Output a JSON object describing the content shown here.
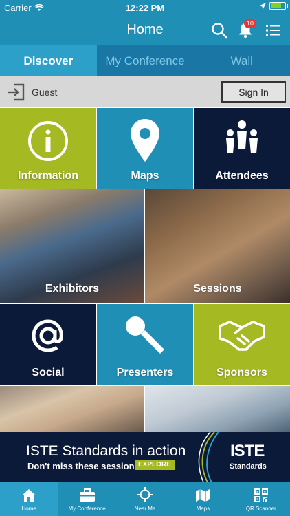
{
  "status": {
    "carrier": "Carrier",
    "time": "12:22 PM"
  },
  "nav": {
    "title": "Home",
    "badge": "10"
  },
  "tabs": [
    {
      "label": "Discover",
      "active": true
    },
    {
      "label": "My Conference",
      "active": false
    },
    {
      "label": "Wall",
      "active": false
    }
  ],
  "guest": {
    "label": "Guest",
    "signin": "Sign In"
  },
  "tiles": {
    "information": "Information",
    "maps": "Maps",
    "attendees": "Attendees",
    "exhibitors": "Exhibitors",
    "sessions": "Sessions",
    "social": "Social",
    "presenters": "Presenters",
    "sponsors": "Sponsors"
  },
  "banner": {
    "title": "ISTE Standards in action",
    "subtitle": "Don't miss these sessions!",
    "explore": "EXPLORE",
    "logo_top": "ISTE",
    "logo_bottom": "Standards"
  },
  "tabbar": [
    {
      "label": "Home",
      "icon": "home-icon",
      "active": true
    },
    {
      "label": "My Conference",
      "icon": "briefcase-icon",
      "active": false
    },
    {
      "label": "Near Me",
      "icon": "crosshair-icon",
      "active": false
    },
    {
      "label": "Maps",
      "icon": "map-icon",
      "active": false
    },
    {
      "label": "QR Scanner",
      "icon": "qr-code-icon",
      "active": false
    }
  ],
  "colors": {
    "primary": "#1f8fb5",
    "green": "#a5b922",
    "navy": "#0c1a3a",
    "badge": "#e53935"
  }
}
